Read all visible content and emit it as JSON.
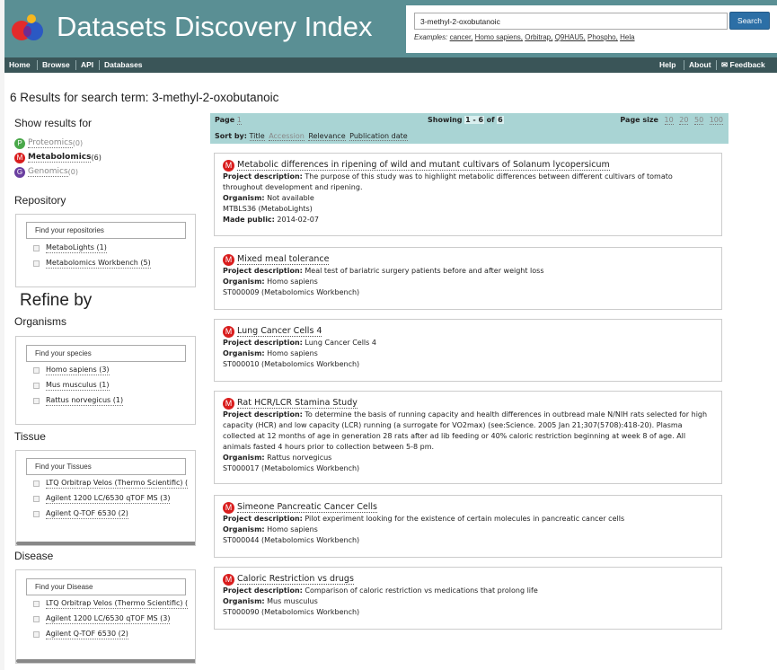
{
  "header": {
    "title": "Datasets Discovery Index",
    "search_value": "3-methyl-2-oxobutanoic",
    "search_button": "Search",
    "examples_label": "Examples:",
    "examples": [
      "cancer,",
      "Homo sapiens,",
      "Orbitrap,",
      "Q9HAU5,",
      "Phospho,",
      "Hela"
    ],
    "logo_colors": [
      "#e32b2b",
      "#2b59c3",
      "#f7b71d",
      "#6f2c91"
    ]
  },
  "nav": {
    "left": [
      "Home",
      "Browse",
      "API",
      "Databases"
    ],
    "right": [
      "Help",
      "About",
      "Feedback"
    ]
  },
  "results": {
    "count_label": "6 Results for search term: 3-methyl-2-oxobutanoic"
  },
  "sidebar": {
    "show_results_for": "Show results for",
    "omics": [
      {
        "letter": "P",
        "name": "Proteomics",
        "count": "(0)",
        "color": "#4aa84a",
        "active": false
      },
      {
        "letter": "M",
        "name": "Metabolomics",
        "count": "(6)",
        "color": "#d91d1d",
        "active": true
      },
      {
        "letter": "G",
        "name": "Genomics",
        "count": "(0)",
        "color": "#6b3fa0",
        "active": false
      }
    ],
    "repository": {
      "heading": "Repository",
      "placeholder": "Find your repositories",
      "items": [
        "MetaboLights (1)",
        "Metabolomics Workbench (5)"
      ]
    },
    "refine_by": "Refine by",
    "organisms": {
      "heading": "Organisms",
      "placeholder": "Find your species",
      "items": [
        "Homo sapiens (3)",
        "Mus musculus (1)",
        "Rattus norvegicus (1)"
      ]
    },
    "tissue": {
      "heading": "Tissue",
      "placeholder": "Find your Tissues",
      "items": [
        "LTQ Orbitrap Velos (Thermo Scientific) (",
        "Agilent 1200 LC/6530 qTOF MS (3)",
        "Agilent Q-TOF 6530 (2)"
      ]
    },
    "disease": {
      "heading": "Disease",
      "placeholder": "Find your Disease",
      "items": [
        "LTQ Orbitrap Velos (Thermo Scientific) (",
        "Agilent 1200 LC/6530 qTOF MS (3)",
        "Agilent Q-TOF 6530 (2)"
      ]
    }
  },
  "pager": {
    "page_label": "Page",
    "page_num": "1",
    "showing_label": "Showing",
    "showing_range": "1 - 6",
    "of_label": "of",
    "total": "6",
    "page_size_label": "Page size",
    "page_sizes": [
      "10",
      "20",
      "50",
      "100"
    ],
    "sort_label": "Sort by:",
    "sort_options": [
      "Title",
      "Accession",
      "Relevance",
      "Publication date"
    ]
  },
  "labels": {
    "project_description": "Project description:",
    "organism": "Organism:",
    "made_public": "Made public:"
  },
  "datasets": [
    {
      "title": "Metabolic differences in ripening of wild and mutant cultivars of Solanum lycopersicum",
      "description": "The purpose of this study was to highlight metabolic differences between different cultivars of tomato throughout development and ripening.",
      "organism": "Not available",
      "accession": "MTBLS36 (MetaboLights)",
      "made_public": "2014-02-07"
    },
    {
      "title": "Mixed meal tolerance",
      "description": "Meal test of bariatric surgery patients before and after weight loss",
      "organism": "Homo sapiens",
      "accession": "ST000009 (Metabolomics Workbench)"
    },
    {
      "title": "Lung Cancer Cells 4",
      "description": "Lung Cancer Cells 4",
      "organism": "Homo sapiens",
      "accession": "ST000010 (Metabolomics Workbench)"
    },
    {
      "title": "Rat HCR/LCR Stamina Study",
      "description": "To determine the basis of running capacity and health differences in outbread male N/NIH rats selected for high capacity (HCR) and low capacity (LCR) running (a surrogate for VO2max) (see:Science. 2005 Jan 21;307(5708):418-20). Plasma collected at 12 months of age in generation 28 rats after ad lib feeding or 40% caloric restriction beginning at week 8 of age. All animals fasted 4 hours prior to collection between 5-8 pm.",
      "organism": "Rattus norvegicus",
      "accession": "ST000017 (Metabolomics Workbench)"
    },
    {
      "title": "Simeone Pancreatic Cancer Cells",
      "description": "Pilot experiment looking for the existence of certain molecules in pancreatic cancer cells",
      "organism": "Homo sapiens",
      "accession": "ST000044 (Metabolomics Workbench)"
    },
    {
      "title": "Caloric Restriction vs drugs",
      "description": "Comparison of caloric restriction vs medications that prolong life",
      "organism": "Mus musculus",
      "accession": "ST000090 (Metabolomics Workbench)"
    }
  ]
}
